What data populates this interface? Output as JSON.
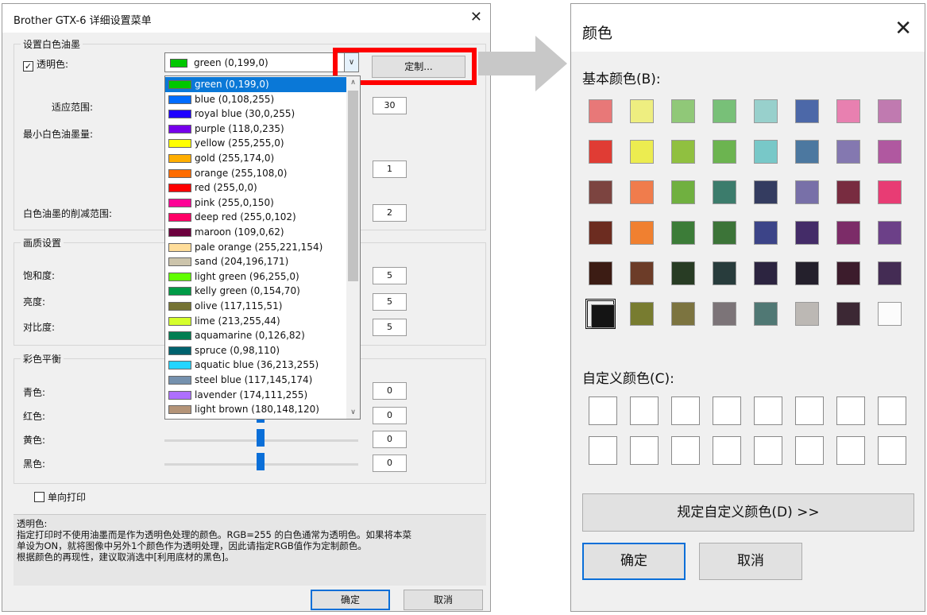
{
  "left_dialog": {
    "title": "Brother GTX-6 详细设置菜单",
    "white_ink_group": "设置白色油墨",
    "transparent_label": "透明色:",
    "transparent_checked": true,
    "selected_color": "green (0,199,0)",
    "custom_button": "定制...",
    "adapt_range_label": "适应范围:",
    "adapt_range_value": "30",
    "min_white_label": "最小白色油墨量:",
    "min_white_value": "1",
    "reduction_label": "白色油墨的削减范围:",
    "reduction_value": "2",
    "quality_group": "画质设置",
    "saturation_label": "饱和度:",
    "saturation_value": "5",
    "brightness_label": "亮度:",
    "brightness_value": "5",
    "contrast_label": "对比度:",
    "contrast_value": "5",
    "balance_group": "彩色平衡",
    "cyan_label": "青色:",
    "cyan_value": "0",
    "red_label": "红色:",
    "red_value": "0",
    "yellow_label": "黄色:",
    "yellow_value": "0",
    "black_label": "黑色:",
    "black_value": "0",
    "unidirectional_label": "单向打印",
    "help_lines": [
      "透明色:",
      "指定打印时不使用油墨而是作为透明色处理的颜色。RGB=255 的白色通常为透明色。如果将本菜",
      "单设为ON，就将图像中另外1个颜色作为透明处理，因此请指定RGB值作为定制颜色。",
      "根据颜色的再现性，建议取消选中[利用底材的黑色]。"
    ],
    "ok": "确定",
    "cancel": "取消"
  },
  "dropdown_items": [
    {
      "label": "green (0,199,0)",
      "color": "#00c700"
    },
    {
      "label": "blue (0,108,255)",
      "color": "#006cff"
    },
    {
      "label": "royal blue (30,0,255)",
      "color": "#1e00ff"
    },
    {
      "label": "purple (118,0,235)",
      "color": "#7600eb"
    },
    {
      "label": "yellow (255,255,0)",
      "color": "#ffff00"
    },
    {
      "label": "gold (255,174,0)",
      "color": "#ffae00"
    },
    {
      "label": "orange (255,108,0)",
      "color": "#ff6c00"
    },
    {
      "label": "red (255,0,0)",
      "color": "#ff0000"
    },
    {
      "label": "pink (255,0,150)",
      "color": "#ff0096"
    },
    {
      "label": "deep red (255,0,102)",
      "color": "#ff0066"
    },
    {
      "label": "maroon (109,0,62)",
      "color": "#6d003e"
    },
    {
      "label": "pale orange (255,221,154)",
      "color": "#ffdd9a"
    },
    {
      "label": "sand (204,196,171)",
      "color": "#ccc4ab"
    },
    {
      "label": "light green (96,255,0)",
      "color": "#60ff00"
    },
    {
      "label": "kelly green (0,154,70)",
      "color": "#009a46"
    },
    {
      "label": "olive (117,115,51)",
      "color": "#757333"
    },
    {
      "label": "lime (213,255,44)",
      "color": "#d5ff2c"
    },
    {
      "label": "aquamarine (0,126,82)",
      "color": "#007e52"
    },
    {
      "label": "spruce (0,98,110)",
      "color": "#00626e"
    },
    {
      "label": "aquatic blue (36,213,255)",
      "color": "#24d5ff"
    },
    {
      "label": "steel blue (117,145,174)",
      "color": "#7591ae"
    },
    {
      "label": "lavender (174,111,255)",
      "color": "#ae6fff"
    },
    {
      "label": "light brown (180,148,120)",
      "color": "#b49478"
    }
  ],
  "color_dialog": {
    "title": "颜色",
    "basic_colors_label": "基本颜色(B):",
    "custom_colors_label": "自定义颜色(C):",
    "define_button": "规定自定义颜色(D) >>",
    "ok": "确定",
    "cancel": "取消",
    "basic_colors": [
      "#e87878",
      "#eeee80",
      "#90c878",
      "#78c078",
      "#98d0cc",
      "#4c68a8",
      "#e880b0",
      "#c07ab0",
      "#e03c34",
      "#ecec50",
      "#90c040",
      "#6cb450",
      "#78c8c8",
      "#4c78a0",
      "#8478b0",
      "#b058a0",
      "#7c4440",
      "#f07c4c",
      "#70b040",
      "#3c7c6c",
      "#343c60",
      "#7870a8",
      "#782c40",
      "#e83c74",
      "#6c2c20",
      "#f08030",
      "#3c7c38",
      "#3c7438",
      "#3c4488",
      "#442c68",
      "#7c2c68",
      "#6c4088",
      "#3c1c14",
      "#6c3c28",
      "#283c24",
      "#283c3c",
      "#2c2440",
      "#24202c",
      "#3c1c2c",
      "#442c54",
      "#141414",
      "#787c30",
      "#7c7440",
      "#7c7478",
      "#507874",
      "#bcb8b4",
      "#3c2834",
      "#fcfcfc"
    ]
  }
}
